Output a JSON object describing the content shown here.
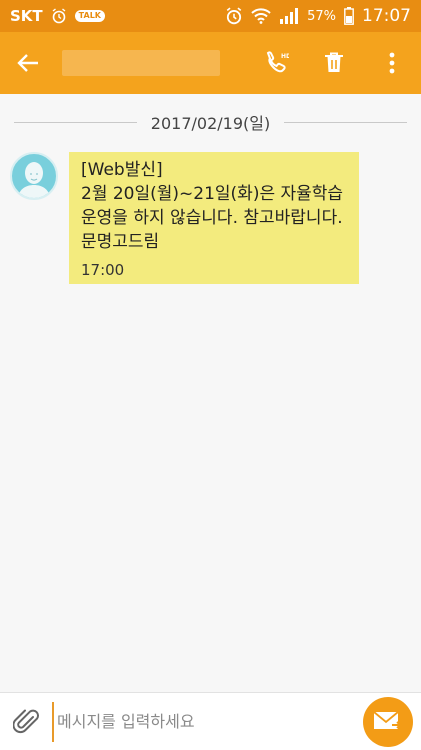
{
  "status_bar": {
    "carrier": "SKT",
    "talk_badge": "TALK",
    "battery_percent": "57%",
    "time": "17:07"
  },
  "app_bar": {
    "hd_badge": "HD"
  },
  "conversation": {
    "date": "2017/02/19(일)",
    "messages": [
      {
        "body": "[Web발신]\n2월 20일(월)~21일(화)은 자율학습\n운영을 하지 않습니다. 참고바랍니다.\n문명고드림",
        "time": "17:00"
      }
    ]
  },
  "composer": {
    "placeholder": "메시지를 입력하세요"
  },
  "colors": {
    "status_bar": "#e88d12",
    "app_bar": "#f4a31d",
    "bubble": "#f3eb7e",
    "send_button": "#f39c16"
  }
}
